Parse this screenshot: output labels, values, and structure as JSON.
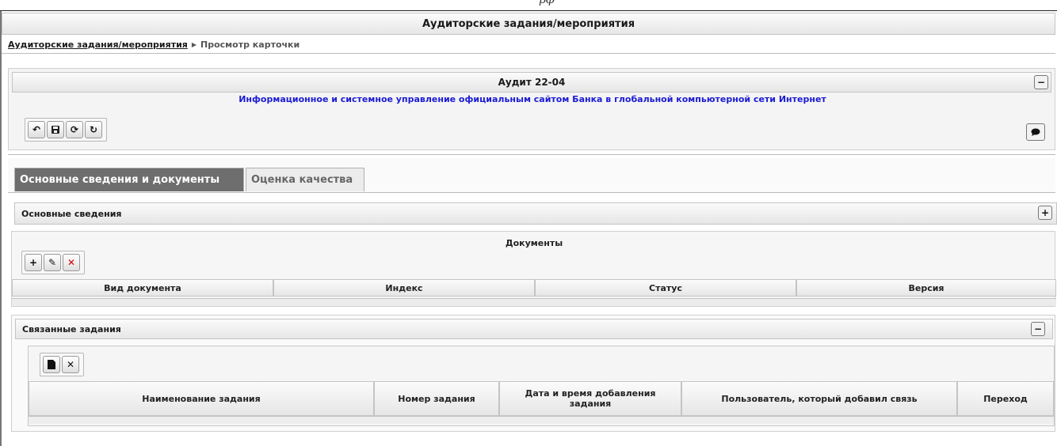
{
  "header_fragment": "рф",
  "page_title": "Аудиторские задания/мероприятия",
  "breadcrumb": {
    "link": "Аудиторские задания/мероприятия",
    "separator": "▶",
    "current": "Просмотр карточки"
  },
  "card": {
    "title": "Аудит 22-04",
    "subtitle": "Информационное и системное управление официальным сайтом Банка в глобальной компьютерной сети Интернет",
    "collapse_symbol": "−",
    "toolbar": {
      "back_icon": "↶",
      "save_icon": "💾",
      "refresh_icon": "⟳",
      "reload_icon": "↻"
    },
    "comment_icon": "💬"
  },
  "tabs": [
    {
      "label": "Основные сведения и документы",
      "active": true
    },
    {
      "label": "Оценка качества",
      "active": false
    }
  ],
  "sections": {
    "basic": {
      "title": "Основные сведения",
      "expand_symbol": "+"
    },
    "documents": {
      "title": "Документы",
      "toolbar": {
        "add_icon": "+",
        "edit_icon": "✎",
        "delete_icon": "✕"
      },
      "columns": [
        "Вид документа",
        "Индекс",
        "Статус",
        "Версия"
      ]
    },
    "linked": {
      "title": "Связанные задания",
      "collapse_symbol": "−",
      "toolbar": {
        "new_icon": "▮",
        "remove_icon": "✕"
      },
      "columns": [
        "Наименование задания",
        "Номер задания",
        "Дата и время добавления задания",
        "Пользователь, который добавил связь",
        "Переход"
      ]
    }
  },
  "colors": {
    "subtitle_blue": "#1b1bd6",
    "active_tab": "#6e6e6e",
    "delete_red": "#d40000"
  }
}
